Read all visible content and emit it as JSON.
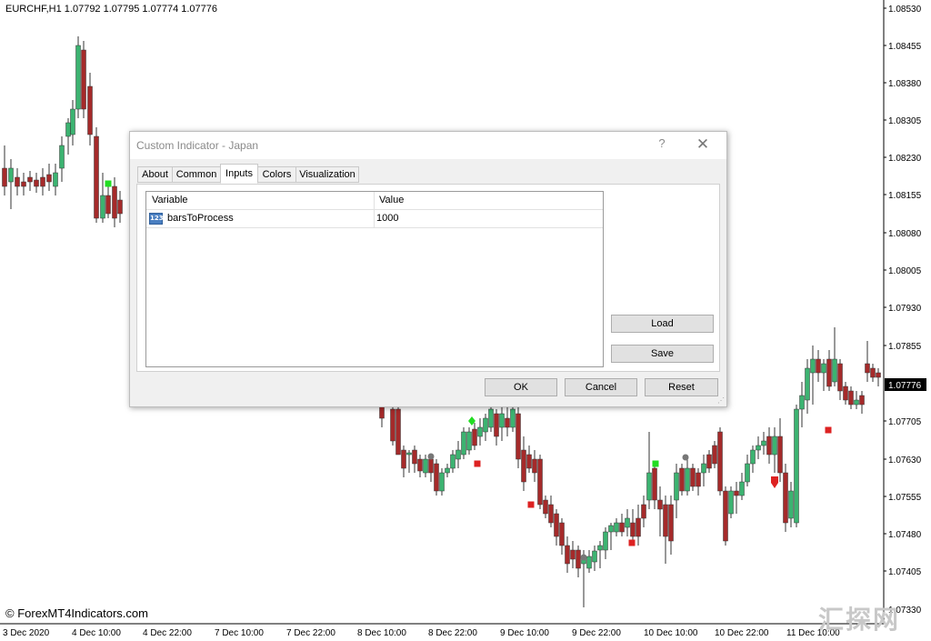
{
  "chart": {
    "symbol_header": "EURCHF,H1  1.07792 1.07795 1.07774 1.07776",
    "current_price": "1.07776",
    "price_labels": [
      "1.08530",
      "1.08455",
      "1.08380",
      "1.08305",
      "1.08230",
      "1.08155",
      "1.08080",
      "1.08005",
      "1.07930",
      "1.07855",
      "1.07705",
      "1.07630",
      "1.07555",
      "1.07480",
      "1.07405",
      "1.07330"
    ],
    "time_labels": [
      "3 Dec 2020",
      "4 Dec 10:00",
      "4 Dec 22:00",
      "7 Dec 10:00",
      "7 Dec 22:00",
      "8 Dec 10:00",
      "8 Dec 22:00",
      "9 Dec 10:00",
      "9 Dec 22:00",
      "10 Dec 10:00",
      "10 Dec 22:00",
      "11 Dec 10:00"
    ],
    "copyright": "© ForexMT4Indicators.com",
    "watermark": "汇探网",
    "colors": {
      "bull": "#3cb371",
      "bear": "#a52a2a",
      "price_tag_bg": "#000000"
    }
  },
  "dialog": {
    "title": "Custom Indicator - Japan",
    "help_glyph": "?",
    "close_glyph": "✕",
    "tabs": [
      {
        "label": "About"
      },
      {
        "label": "Common"
      },
      {
        "label": "Inputs"
      },
      {
        "label": "Colors"
      },
      {
        "label": "Visualization"
      }
    ],
    "active_tab": "Inputs",
    "table": {
      "headers": {
        "variable": "Variable",
        "value": "Value"
      },
      "rows": [
        {
          "icon": "123",
          "variable": "barsToProcess",
          "value": "1000"
        }
      ]
    },
    "buttons": {
      "load": "Load",
      "save": "Save",
      "ok": "OK",
      "cancel": "Cancel",
      "reset": "Reset"
    }
  }
}
